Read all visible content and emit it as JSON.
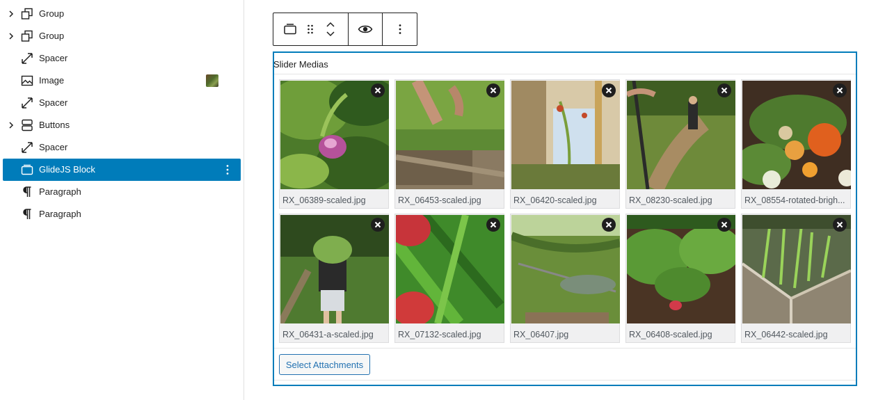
{
  "list_view": {
    "items": [
      {
        "label": "Group",
        "icon": "group-icon",
        "expandable": true
      },
      {
        "label": "Group",
        "icon": "group-icon",
        "expandable": true
      },
      {
        "label": "Spacer",
        "icon": "spacer-icon",
        "expandable": false
      },
      {
        "label": "Image",
        "icon": "image-icon",
        "expandable": false
      },
      {
        "label": "Spacer",
        "icon": "spacer-icon",
        "expandable": false
      },
      {
        "label": "Buttons",
        "icon": "buttons-icon",
        "expandable": true
      },
      {
        "label": "Spacer",
        "icon": "spacer-icon",
        "expandable": false
      },
      {
        "label": "GlideJS Block",
        "icon": "slider-block-icon",
        "expandable": false,
        "selected": true
      },
      {
        "label": "Paragraph",
        "icon": "paragraph-icon",
        "expandable": false
      },
      {
        "label": "Paragraph",
        "icon": "paragraph-icon",
        "expandable": false
      }
    ]
  },
  "toolbar": {
    "buttons": [
      "slider-block-icon",
      "drag-handle-icon",
      "move-up-down-icon",
      "preview-eye-icon",
      "more-options-icon"
    ]
  },
  "block": {
    "title": "Slider Medias",
    "select_button_label": "Select Attachments",
    "media": [
      {
        "filename": "RX_06389-scaled.jpg"
      },
      {
        "filename": "RX_06453-scaled.jpg"
      },
      {
        "filename": "RX_06420-scaled.jpg"
      },
      {
        "filename": "RX_08230-scaled.jpg"
      },
      {
        "filename": "RX_08554-rotated-brigh..."
      },
      {
        "filename": "RX_06431-a-scaled.jpg"
      },
      {
        "filename": "RX_07132-scaled.jpg"
      },
      {
        "filename": "RX_06407.jpg"
      },
      {
        "filename": "RX_06408-scaled.jpg"
      },
      {
        "filename": "RX_06442-scaled.jpg"
      }
    ]
  },
  "colors": {
    "accent": "#007cba",
    "button_blue": "#2271b1",
    "text": "#1e1e1e"
  }
}
